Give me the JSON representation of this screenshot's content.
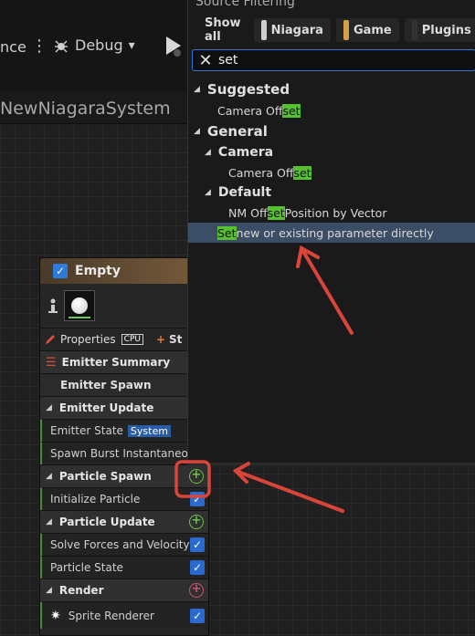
{
  "toolbar": {
    "ince_label": "nce",
    "dots": "⋮",
    "debug_label": "Debug",
    "chevron": "⌄"
  },
  "tab": {
    "title": "NewNiagaraSystem"
  },
  "node": {
    "title": "Empty",
    "properties_label": "Properties",
    "cpu_badge": "CPU",
    "st_label": "St",
    "rows": {
      "emitter_summary": "Emitter Summary",
      "emitter_spawn": "Emitter Spawn",
      "emitter_update": "Emitter Update",
      "emitter_state": "Emitter State",
      "emitter_state_badge": "System",
      "spawn_burst": "Spawn Burst Instantaneous",
      "particle_spawn": "Particle Spawn",
      "initialize_particle": "Initialize Particle",
      "particle_update": "Particle Update",
      "solve_forces": "Solve Forces and Velocity",
      "particle_state": "Particle State",
      "render": "Render",
      "sprite_renderer": "Sprite Renderer"
    }
  },
  "popup": {
    "title": "Source Filtering",
    "filters": [
      {
        "label": "Show all",
        "color": ""
      },
      {
        "label": "Niagara",
        "color": "#cfcfcf"
      },
      {
        "label": "Game",
        "color": "#d6a04a"
      },
      {
        "label": "Plugins",
        "color": ""
      }
    ],
    "search_value": "set",
    "items": {
      "suggested": "Suggested",
      "s1_pre": "Camera Off",
      "s1_hl": "set",
      "s1_post": "",
      "general": "General",
      "camera": "Camera",
      "c1_pre": "Camera Off",
      "c1_hl": "set",
      "c1_post": "",
      "default": "Default",
      "d1_pre": "NM Off",
      "d1_hl": "set",
      "d1_post": " Position by Vector",
      "d2_pre": "",
      "d2_hl": "Set",
      "d2_post": " new or existing parameter directly"
    }
  },
  "colors": {
    "annotation_red": "#d9453a",
    "highlight_green": "#57c030",
    "selection": "#3c4e66"
  }
}
